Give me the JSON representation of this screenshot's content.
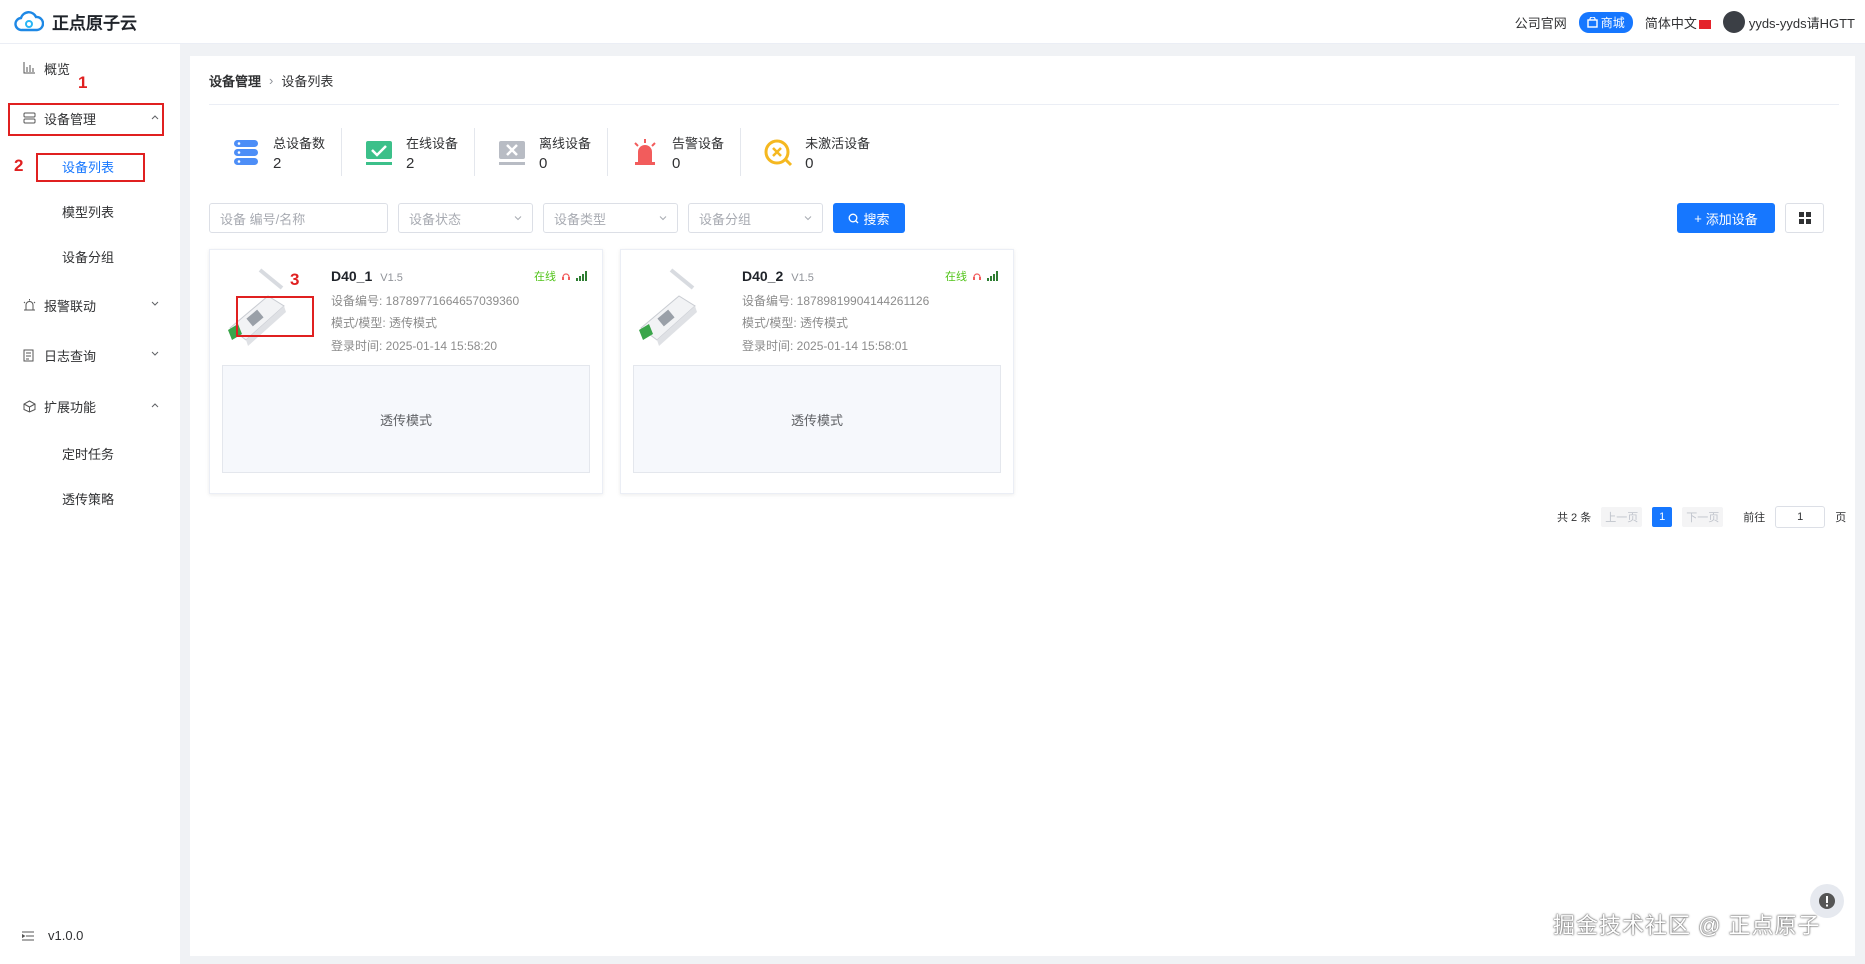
{
  "app": {
    "name": "正点原子云"
  },
  "topbar": {
    "links": [
      "公司官网"
    ],
    "mall_label": "商城",
    "language": "简体中文",
    "username": "yyds-yyds请HGTT"
  },
  "sidebar": {
    "items": [
      {
        "label": "概览",
        "icon": "chart-icon"
      },
      {
        "label": "设备管理",
        "icon": "server-icon",
        "expanded": true
      },
      {
        "label": "报警联动",
        "icon": "alarm-icon",
        "expanded": false
      },
      {
        "label": "日志查询",
        "icon": "log-icon",
        "expanded": false
      },
      {
        "label": "扩展功能",
        "icon": "cube-icon",
        "expanded": true
      }
    ],
    "device_sub": [
      "设备列表",
      "模型列表",
      "设备分组"
    ],
    "ext_sub": [
      "定时任务",
      "透传策略"
    ],
    "version": "v1.0.0",
    "annotations": [
      "1",
      "2",
      "3"
    ]
  },
  "breadcrumb": [
    "设备管理",
    "设备列表"
  ],
  "stats": [
    {
      "label": "总设备数",
      "value": "2",
      "icon": "server-stack-icon",
      "color": "#4d8ef7"
    },
    {
      "label": "在线设备",
      "value": "2",
      "icon": "online-check-icon",
      "color": "#3cc08a"
    },
    {
      "label": "离线设备",
      "value": "0",
      "icon": "offline-x-icon",
      "color": "#b8bcc4"
    },
    {
      "label": "告警设备",
      "value": "0",
      "icon": "siren-icon",
      "color": "#f25c5c"
    },
    {
      "label": "未激活设备",
      "value": "0",
      "icon": "inactive-clock-icon",
      "color": "#f5b820"
    }
  ],
  "filters": {
    "search_placeholder": "设备 编号/名称",
    "status_placeholder": "设备状态",
    "type_placeholder": "设备类型",
    "group_placeholder": "设备分组",
    "search_label": "搜索",
    "add_label": "添加设备"
  },
  "devices": [
    {
      "name": "D40_1",
      "version": "V1.5",
      "status": "在线",
      "id_line": "设备编号: 18789771664657039360",
      "mode_line": "模式/模型: 透传模式",
      "login_line": "登录时间: 2025-01-14 15:58:20",
      "mode_box": "透传模式"
    },
    {
      "name": "D40_2",
      "version": "V1.5",
      "status": "在线",
      "id_line": "设备编号: 18789819904144261126",
      "mode_line": "模式/模型: 透传模式",
      "login_line": "登录时间: 2025-01-14 15:58:01",
      "mode_box": "透传模式"
    }
  ],
  "pagination": {
    "total": "共 2 条",
    "prev": "上一页",
    "current": "1",
    "next": "下一页",
    "goto": "前往",
    "goto_value": "1",
    "page_suffix": "页"
  },
  "watermark": "掘金技术社区 @ 正点原子",
  "colors": {
    "primary": "#1677ff",
    "online": "#52c41a",
    "annotation": "#e02020"
  }
}
